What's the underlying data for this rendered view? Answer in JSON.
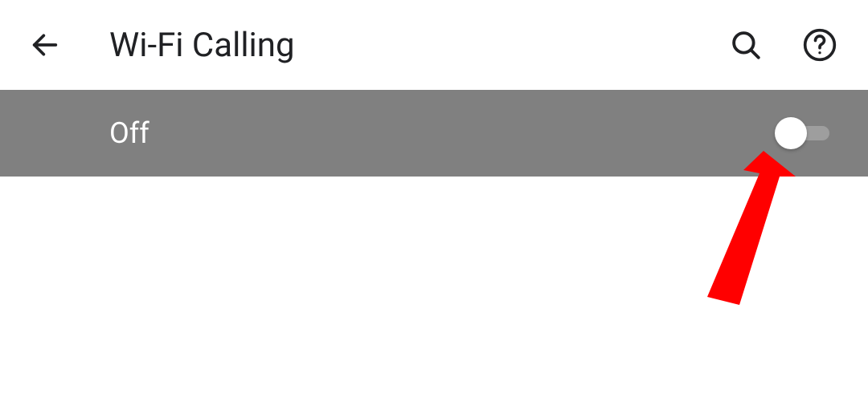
{
  "header": {
    "title": "Wi-Fi Calling"
  },
  "setting": {
    "state_label": "Off",
    "switch_checked": false
  },
  "annotation": {
    "color": "#FF0000"
  }
}
